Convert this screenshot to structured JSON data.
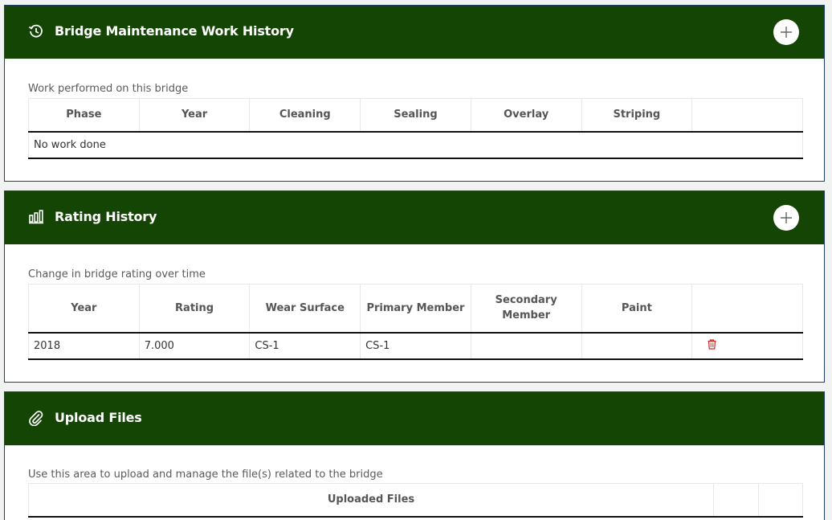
{
  "maintenance": {
    "title": "Bridge Maintenance Work History",
    "description": "Work performed on this bridge",
    "columns": [
      "Phase",
      "Year",
      "Cleaning",
      "Sealing",
      "Overlay",
      "Striping",
      ""
    ],
    "empty_text": "No work done",
    "header_icon": "history-icon",
    "add_icon": "plus-icon"
  },
  "rating": {
    "title": "Rating History",
    "description": "Change in bridge rating over time",
    "columns": [
      "Year",
      "Rating",
      "Wear Surface",
      "Primary Member",
      "Secondary Member",
      "Paint",
      ""
    ],
    "rows": [
      {
        "year": "2018",
        "rating": "7.000",
        "wear_surface": "CS-1",
        "primary_member": "CS-1",
        "secondary_member": "",
        "paint": ""
      }
    ],
    "header_icon": "bar-chart-icon",
    "add_icon": "plus-icon",
    "delete_icon": "trash-icon"
  },
  "upload": {
    "title": "Upload Files",
    "description": "Use this area to upload and manage the file(s) related to the bridge",
    "column": "Uploaded Files",
    "header_icon": "paperclip-icon"
  },
  "colors": {
    "header_bg": "#154505",
    "card_border": "#1d3f6a",
    "trash": "#c62828"
  }
}
